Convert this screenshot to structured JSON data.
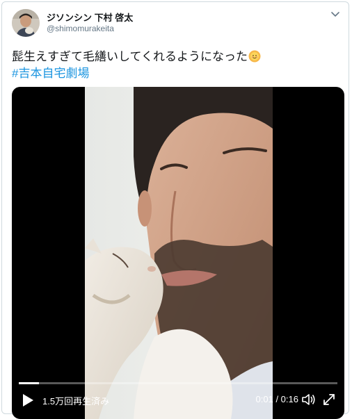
{
  "tweet": {
    "author_name": "ジソンシン 下村 啓太",
    "handle": "@shimomurakeita",
    "text": "髭生えすぎて毛繕いしてくれるようになった",
    "hashtag": "#吉本自宅劇場"
  },
  "video": {
    "views": "1.5万回再生済み",
    "time": "0:01 / 0:16",
    "progress_fraction": 0.0625
  },
  "icons": {
    "menu": "chevron-down-icon",
    "emoji": "smiling-sun-emoji",
    "play": "play-icon",
    "volume": "volume-icon",
    "fullscreen": "fullscreen-icon"
  },
  "colors": {
    "hashtag": "#1b95e0",
    "handle": "#657786",
    "border": "#cfd9de"
  }
}
